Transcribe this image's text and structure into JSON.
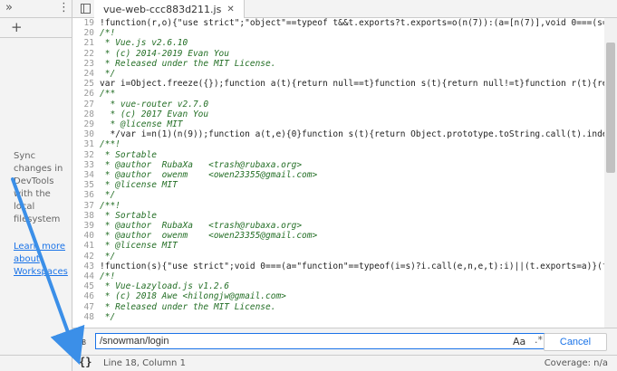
{
  "left_panel": {
    "sync_text": "Sync changes in DevTools with the local filesystem",
    "learn_link": "Learn more about Workspaces"
  },
  "tab": {
    "label": "vue-web-ccc883d211.js"
  },
  "code_lines": [
    {
      "n": 19,
      "t": "!function(r,o){\"use strict\";\"object\"==typeof t&&t.exports?t.exports=o(n(7)):(a=[n(7)],void 0===(s=\"functio",
      "k": "txt"
    },
    {
      "n": 20,
      "t": "/*!",
      "k": "c"
    },
    {
      "n": 21,
      "t": " * Vue.js v2.6.10",
      "k": "c"
    },
    {
      "n": 22,
      "t": " * (c) 2014-2019 Evan You",
      "k": "c"
    },
    {
      "n": 23,
      "t": " * Released under the MIT License.",
      "k": "c"
    },
    {
      "n": 24,
      "t": " */",
      "k": "c"
    },
    {
      "n": 25,
      "t": "var i=Object.freeze({});function a(t){return null==t}function s(t){return null!=t}function r(t){return!0==",
      "k": "txt"
    },
    {
      "n": 26,
      "t": "/**",
      "k": "c"
    },
    {
      "n": 27,
      "t": "  * vue-router v2.7.0",
      "k": "c"
    },
    {
      "n": 28,
      "t": "  * (c) 2017 Evan You",
      "k": "c"
    },
    {
      "n": 29,
      "t": "  * @license MIT",
      "k": "c"
    },
    {
      "n": 30,
      "t": "  */var i=n(1)(n(9));function a(t,e){0}function s(t){return Object.prototype.toString.call(t).indexOf(\"Err",
      "k": "txt"
    },
    {
      "n": 31,
      "t": "/**!",
      "k": "c"
    },
    {
      "n": 32,
      "t": " * Sortable",
      "k": "c"
    },
    {
      "n": 33,
      "t": " * @author  RubaXa   <trash@rubaxa.org>",
      "k": "c"
    },
    {
      "n": 34,
      "t": " * @author  owenm    <owen23355@gmail.com>",
      "k": "c"
    },
    {
      "n": 35,
      "t": " * @license MIT",
      "k": "c"
    },
    {
      "n": 36,
      "t": " */",
      "k": "c"
    },
    {
      "n": 37,
      "t": "/**!",
      "k": "c"
    },
    {
      "n": 38,
      "t": " * Sortable",
      "k": "c"
    },
    {
      "n": 39,
      "t": " * @author  RubaXa   <trash@rubaxa.org>",
      "k": "c"
    },
    {
      "n": 40,
      "t": " * @author  owenm    <owen23355@gmail.com>",
      "k": "c"
    },
    {
      "n": 41,
      "t": " * @license MIT",
      "k": "c"
    },
    {
      "n": 42,
      "t": " */",
      "k": "c"
    },
    {
      "n": 43,
      "t": "!function(s){\"use strict\";void 0===(a=\"function\"==typeof(i=s)?i.call(e,n,e,t):i)||(t.exports=a)}(function(",
      "k": "txt"
    },
    {
      "n": 44,
      "t": "/*!",
      "k": "c"
    },
    {
      "n": 45,
      "t": " * Vue-Lazyload.js v1.2.6",
      "k": "c"
    },
    {
      "n": 46,
      "t": " * (c) 2018 Awe <hilongjw@gmail.com>",
      "k": "c"
    },
    {
      "n": 47,
      "t": " * Released under the MIT License.",
      "k": "c"
    },
    {
      "n": 48,
      "t": " */",
      "k": "c"
    }
  ],
  "search": {
    "value": "/snowman/login",
    "match_case_label": "Aa",
    "regex_label": ".*",
    "cancel_label": "Cancel"
  },
  "status": {
    "cursor": "Line 18, Column 1",
    "coverage": "Coverage: n/a",
    "braces": "{}"
  },
  "scroll": {
    "position": 0.08,
    "visible": 0.42
  },
  "colors": {
    "accent": "#1a73e8",
    "comment": "#236e25",
    "arrow": "#3b8fe8"
  }
}
